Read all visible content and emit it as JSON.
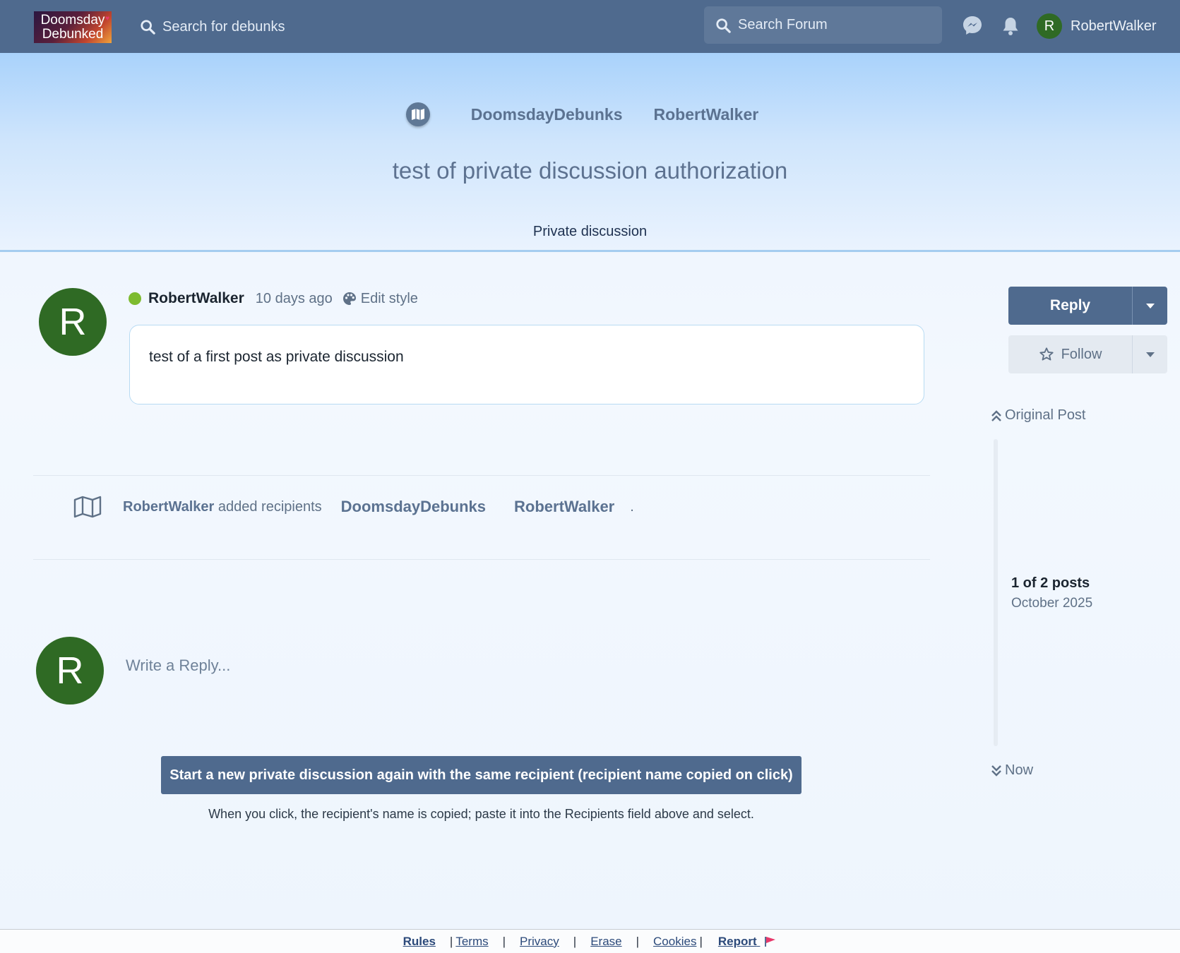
{
  "header": {
    "logo_line1": "Doomsday",
    "logo_line2": "Debunked",
    "search_debunks_label": "Search for debunks",
    "search_forum_placeholder": "Search Forum",
    "user_initial": "R",
    "username": "RobertWalker"
  },
  "hero": {
    "recipients": [
      "DoomsdayDebunks",
      "RobertWalker"
    ],
    "title": "test of private discussion authorization",
    "type_label": "Private discussion"
  },
  "post": {
    "avatar_initial": "R",
    "author": "RobertWalker",
    "time": "10 days ago",
    "edit_style_label": "Edit style",
    "body": "test of a first post as private discussion"
  },
  "event": {
    "user": "RobertWalker",
    "action": "added recipients",
    "recipients": [
      "DoomsdayDebunks",
      "RobertWalker"
    ],
    "period": "."
  },
  "composer": {
    "avatar_initial": "R",
    "placeholder": "Write a Reply..."
  },
  "new_discussion": {
    "button_label": "Start a new private discussion again with the same recipient (recipient name copied on click)",
    "hint": "When you click, the recipient's name is copied; paste it into the Recipients field above and select."
  },
  "sidebar": {
    "reply_label": "Reply",
    "follow_label": "Follow",
    "original_post_label": "Original Post",
    "post_count": "1 of 2 posts",
    "date_label": "October 2025",
    "now_label": "Now"
  },
  "footer": {
    "rules": "Rules",
    "terms": "Terms",
    "privacy": "Privacy",
    "erase": "Erase",
    "cookies": "Cookies",
    "report": "Report"
  },
  "colors": {
    "header_bg": "#4f6a8e",
    "avatar_green": "#2f6a24",
    "online_green": "#7dbb2f",
    "report_flag": "#e8386b"
  }
}
